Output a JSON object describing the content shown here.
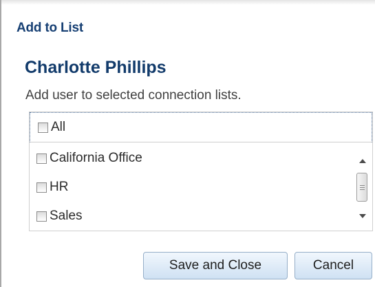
{
  "dialog": {
    "title": "Add to List",
    "user_name": "Charlotte Phillips",
    "instruction": "Add user to selected connection lists."
  },
  "lists": {
    "all_label": "All",
    "all_checked": false,
    "items": [
      {
        "label": "California Office",
        "checked": false
      },
      {
        "label": "HR",
        "checked": false
      },
      {
        "label": "Sales",
        "checked": false
      }
    ]
  },
  "buttons": {
    "save_label": "Save and Close",
    "cancel_label": "Cancel"
  },
  "icons": {
    "checkbox": "checkbox-icon",
    "scroll_up": "scroll-up-arrow-icon",
    "scroll_down": "scroll-down-arrow-icon",
    "scroll_thumb": "scroll-thumb-grip-icon"
  },
  "colors": {
    "title": "#163f73",
    "user_name": "#123b6b",
    "button_border": "#95aec8",
    "focus_outline": "#4d6f9a"
  }
}
